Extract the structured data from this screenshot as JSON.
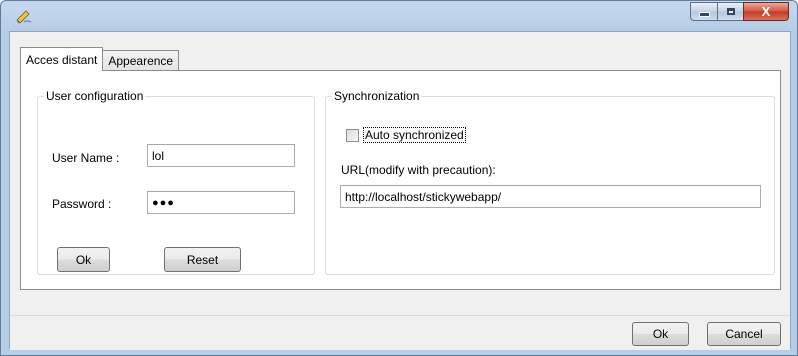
{
  "window": {
    "title": "",
    "icon": "pencil-app-icon",
    "controls": {
      "minimize": "minimize-icon",
      "maximize": "maximize-icon",
      "close_glyph": "X"
    }
  },
  "tabs": [
    {
      "label": "Acces distant",
      "active": true
    },
    {
      "label": "Appearence",
      "active": false
    }
  ],
  "user_config": {
    "legend": "User configuration",
    "username_label": "User Name :",
    "username_value": "lol",
    "password_label": "Password :",
    "password_display": "●●●",
    "ok_label": "Ok",
    "reset_label": "Reset"
  },
  "sync": {
    "legend": "Synchronization",
    "auto_sync_label": "Auto synchronized",
    "auto_sync_checked": false,
    "url_label": "URL(modify with precaution):",
    "url_value": "http://localhost/stickywebapp/"
  },
  "footer": {
    "ok_label": "Ok",
    "cancel_label": "Cancel"
  },
  "colors": {
    "titlebar": "#b9cfe7",
    "close_button": "#c8432e",
    "panel_bg": "#f0f0f0",
    "tab_content_bg": "#ffffff"
  }
}
